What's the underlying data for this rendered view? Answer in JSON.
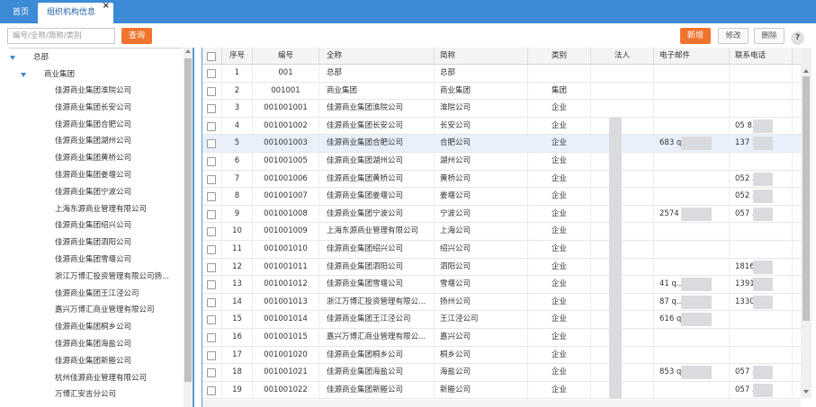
{
  "tabs": {
    "home": "首页",
    "active": "组织机构信息",
    "close": "×"
  },
  "toolbar": {
    "search_placeholder": "编号/全称/简称/类别",
    "query_label": "查询",
    "new_label": "新增",
    "edit_label": "修改",
    "delete_label": "删除",
    "help": "?"
  },
  "colors": {
    "tab_bar": "#3d8ad6",
    "accent_orange": "#f0742d",
    "divider_blue": "#5b9bd5",
    "highlight_row": "#e8f1fb"
  },
  "tree": {
    "root": "总部",
    "group": "商业集团",
    "items": [
      "佳源商业集团淮院公司",
      "佳源商业集团长安公司",
      "佳源商业集团合肥公司",
      "佳源商业集团湖州公司",
      "佳源商业集团黄桥公司",
      "佳源商业集团姜堰公司",
      "佳源商业集团宁波公司",
      "上海东源商业管理有限公司",
      "佳源商业集团绍兴公司",
      "佳源商业集团泗阳公司",
      "佳源商业集团雪堰公司",
      "浙江万博汇投资管理有限公司扬...",
      "佳源商业集团王江泾公司",
      "嘉兴万博汇商业管理有限公司",
      "佳源商业集团桐乡公司",
      "佳源商业集团海盐公司",
      "佳源商业集团新塍公司",
      "杭州佳源商业管理有限公司",
      "万博汇安吉分公司"
    ]
  },
  "grid": {
    "columns": [
      "序号",
      "编号",
      "全称",
      "简称",
      "类别",
      "法人",
      "电子邮件",
      "联系电话"
    ],
    "rows": [
      {
        "seq": "1",
        "code": "001",
        "full": "总部",
        "short": "总部",
        "type": "",
        "email": "",
        "phone": ""
      },
      {
        "seq": "2",
        "code": "001001",
        "full": "商业集团",
        "short": "商业集团",
        "type": "集团",
        "email": "",
        "phone": ""
      },
      {
        "seq": "3",
        "code": "001001001",
        "full": "佳源商业集团淮院公司",
        "short": "淮院公司",
        "type": "企业",
        "email": "",
        "phone": ""
      },
      {
        "seq": "4",
        "code": "001001002",
        "full": "佳源商业集团长安公司",
        "short": "长安公司",
        "type": "企业",
        "email": "",
        "phone": "05 8..."
      },
      {
        "seq": "5",
        "code": "001001003",
        "full": "佳源商业集团合肥公司",
        "short": "合肥公司",
        "type": "企业",
        "email": "683 q...",
        "phone": "137 14"
      },
      {
        "seq": "6",
        "code": "001001005",
        "full": "佳源商业集团湖州公司",
        "short": "湖州公司",
        "type": "企业",
        "email": "",
        "phone": ""
      },
      {
        "seq": "7",
        "code": "001001006",
        "full": "佳源商业集团黄桥公司",
        "short": "黄桥公司",
        "type": "企业",
        "email": "",
        "phone": "052 ..."
      },
      {
        "seq": "8",
        "code": "001001007",
        "full": "佳源商业集团姜堰公司",
        "short": "姜堰公司",
        "type": "企业",
        "email": "",
        "phone": "052 ..."
      },
      {
        "seq": "9",
        "code": "001001008",
        "full": "佳源商业集团宁波公司",
        "short": "宁波公司",
        "type": "企业",
        "email": "2574 q...",
        "phone": "057 ..."
      },
      {
        "seq": "10",
        "code": "001001009",
        "full": "上海东源商业管理有限公司",
        "short": "上海公司",
        "type": "企业",
        "email": "",
        "phone": ""
      },
      {
        "seq": "11",
        "code": "001001010",
        "full": "佳源商业集团绍兴公司",
        "short": "绍兴公司",
        "type": "企业",
        "email": "",
        "phone": ""
      },
      {
        "seq": "12",
        "code": "001001011",
        "full": "佳源商业集团泗阳公司",
        "short": "泗阳公司",
        "type": "企业",
        "email": "",
        "phone": "1816 6"
      },
      {
        "seq": "13",
        "code": "001001012",
        "full": "佳源商业集团雪堰公司",
        "short": "雪堰公司",
        "type": "企业",
        "email": "41 q...",
        "phone": "1391 9"
      },
      {
        "seq": "14",
        "code": "001001013",
        "full": "浙江万博汇投资管理有限公...",
        "short": "扬州公司",
        "type": "企业",
        "email": "87 q...",
        "phone": "1330 1"
      },
      {
        "seq": "15",
        "code": "001001014",
        "full": "佳源商业集团王江泾公司",
        "short": "王江泾公司",
        "type": "企业",
        "email": "616 q...",
        "phone": ""
      },
      {
        "seq": "16",
        "code": "001001015",
        "full": "嘉兴万博汇商业管理有限公...",
        "short": "嘉兴公司",
        "type": "企业",
        "email": "",
        "phone": ""
      },
      {
        "seq": "17",
        "code": "001001020",
        "full": "佳源商业集团桐乡公司",
        "short": "桐乡公司",
        "type": "企业",
        "email": "",
        "phone": ""
      },
      {
        "seq": "18",
        "code": "001001021",
        "full": "佳源商业集团海盐公司",
        "short": "海盐公司",
        "type": "企业",
        "email": "853 q...",
        "phone": "057 ..."
      },
      {
        "seq": "19",
        "code": "001001022",
        "full": "佳源商业集团新塍公司",
        "short": "新塍公司",
        "type": "企业",
        "email": "",
        "phone": "057 ..."
      }
    ]
  }
}
